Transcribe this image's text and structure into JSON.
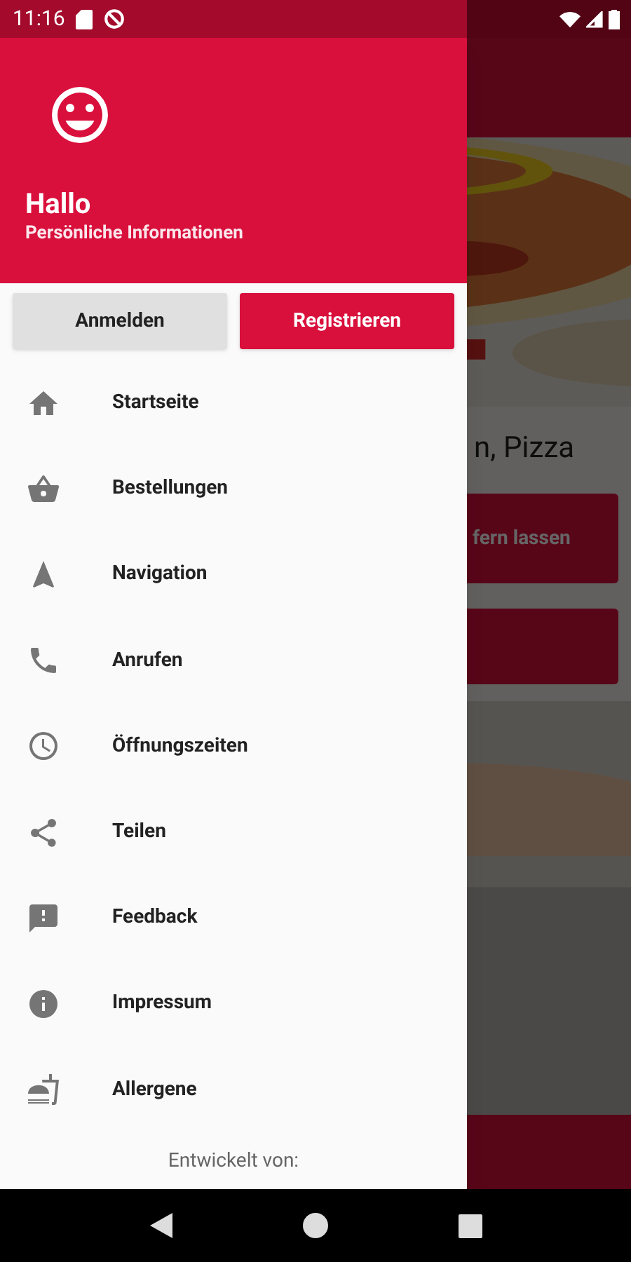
{
  "status_bar": {
    "time": "11:16"
  },
  "background_app": {
    "heading_fragment": "n, Pizza",
    "delivery_button": "fern lassen"
  },
  "drawer": {
    "greeting": "Hallo",
    "subtitle": "Persönliche Informationen",
    "buttons": [
      {
        "label": "Anmelden",
        "kind": "secondary"
      },
      {
        "label": "Registrieren",
        "kind": "primary"
      }
    ],
    "items": [
      {
        "label": "Startseite"
      },
      {
        "label": "Bestellungen"
      },
      {
        "label": "Navigation"
      },
      {
        "label": "Anrufen"
      },
      {
        "label": "Öffnungszeiten"
      },
      {
        "label": "Teilen"
      },
      {
        "label": "Feedback"
      },
      {
        "label": "Impressum"
      },
      {
        "label": "Allergene"
      }
    ],
    "footer": "Entwickelt von:"
  }
}
